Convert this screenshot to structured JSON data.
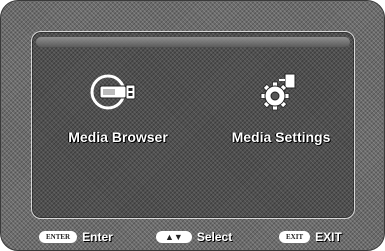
{
  "menu": {
    "items": [
      {
        "label": "Media Browser",
        "icon": "usb-stick-icon"
      },
      {
        "label": "Media Settings",
        "icon": "gear-settings-icon"
      }
    ]
  },
  "footer": {
    "enter": {
      "key": "ENTER",
      "label": "Enter"
    },
    "select": {
      "key": "▲▼",
      "label": "Select"
    },
    "exit": {
      "key": "EXIT",
      "label": "EXIT"
    }
  },
  "colors": {
    "background": "#6c6c6c",
    "panel": "#505050",
    "text": "#ffffff"
  }
}
